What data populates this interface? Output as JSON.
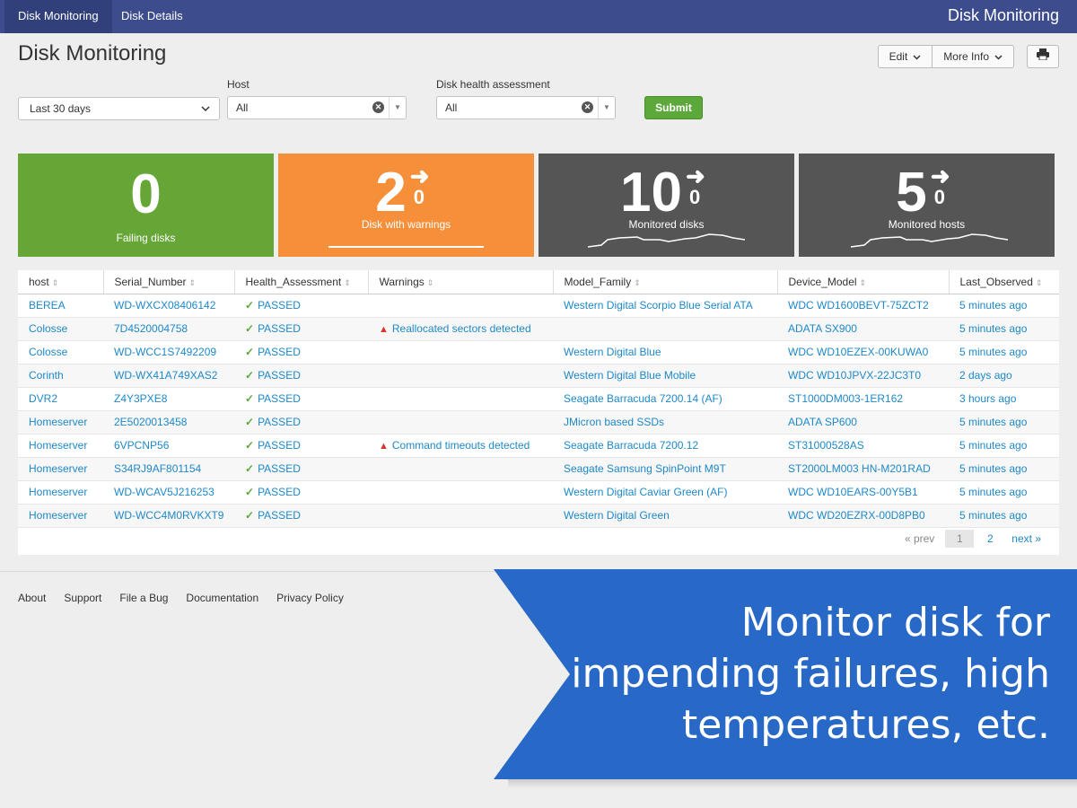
{
  "nav": {
    "tabs": [
      "Disk Monitoring",
      "Disk Details"
    ],
    "app_title": "Disk Monitoring"
  },
  "page": {
    "title": "Disk Monitoring",
    "edit_label": "Edit",
    "more_info_label": "More Info"
  },
  "filters": {
    "time_range": "Last 30 days",
    "host_label": "Host",
    "host_value": "All",
    "health_label": "Disk health assessment",
    "health_value": "All",
    "submit_label": "Submit"
  },
  "cards": [
    {
      "value": "0",
      "label": "Failing disks",
      "color": "#65a637"
    },
    {
      "value": "2",
      "delta": "0",
      "label": "Disk with warnings",
      "color": "#f58f39"
    },
    {
      "value": "10",
      "delta": "0",
      "label": "Monitored disks",
      "color": "#555555"
    },
    {
      "value": "5",
      "delta": "0",
      "label": "Monitored hosts",
      "color": "#555555"
    }
  ],
  "table": {
    "columns": [
      "host",
      "Serial_Number",
      "Health_Assessment",
      "Warnings",
      "Model_Family",
      "Device_Model",
      "Last_Observed"
    ],
    "rows": [
      [
        "BEREA",
        "WD-WXCX08406142",
        "PASSED",
        "",
        "Western Digital Scorpio Blue Serial ATA",
        "WDC WD1600BEVT-75ZCT2",
        "5 minutes ago"
      ],
      [
        "Colosse",
        "7D4520004758",
        "PASSED",
        "Reallocated sectors detected",
        "",
        "ADATA SX900",
        "5 minutes ago"
      ],
      [
        "Colosse",
        "WD-WCC1S7492209",
        "PASSED",
        "",
        "Western Digital Blue",
        "WDC WD10EZEX-00KUWA0",
        "5 minutes ago"
      ],
      [
        "Corinth",
        "WD-WX41A749XAS2",
        "PASSED",
        "",
        "Western Digital Blue Mobile",
        "WDC WD10JPVX-22JC3T0",
        "2 days ago"
      ],
      [
        "DVR2",
        "Z4Y3PXE8",
        "PASSED",
        "",
        "Seagate Barracuda 7200.14 (AF)",
        "ST1000DM003-1ER162",
        "3 hours ago"
      ],
      [
        "Homeserver",
        "2E5020013458",
        "PASSED",
        "",
        "JMicron based SSDs",
        "ADATA SP600",
        "5 minutes ago"
      ],
      [
        "Homeserver",
        "6VPCNP56",
        "PASSED",
        "Command timeouts detected",
        "Seagate Barracuda 7200.12",
        "ST31000528AS",
        "5 minutes ago"
      ],
      [
        "Homeserver",
        "S34RJ9AF801154",
        "PASSED",
        "",
        "Seagate Samsung SpinPoint M9T",
        "ST2000LM003 HN-M201RAD",
        "5 minutes ago"
      ],
      [
        "Homeserver",
        "WD-WCAV5J216253",
        "PASSED",
        "",
        "Western Digital Caviar Green (AF)",
        "WDC WD10EARS-00Y5B1",
        "5 minutes ago"
      ],
      [
        "Homeserver",
        "WD-WCC4M0RVKXT9",
        "PASSED",
        "",
        "Western Digital Green",
        "WDC WD20EZRX-00D8PB0",
        "5 minutes ago"
      ]
    ]
  },
  "pager": {
    "prev": "« prev",
    "pages": [
      "1",
      "2"
    ],
    "next": "next »"
  },
  "footer": [
    "About",
    "Support",
    "File a Bug",
    "Documentation",
    "Privacy Policy"
  ],
  "banner": {
    "lines": [
      "Monitor disk for",
      "impending failures, high",
      "temperatures, etc."
    ]
  },
  "icons": {
    "check": "check-icon",
    "warning": "warning-icon",
    "print": "print-icon",
    "sort": "sort-icon",
    "clear": "clear-icon"
  }
}
